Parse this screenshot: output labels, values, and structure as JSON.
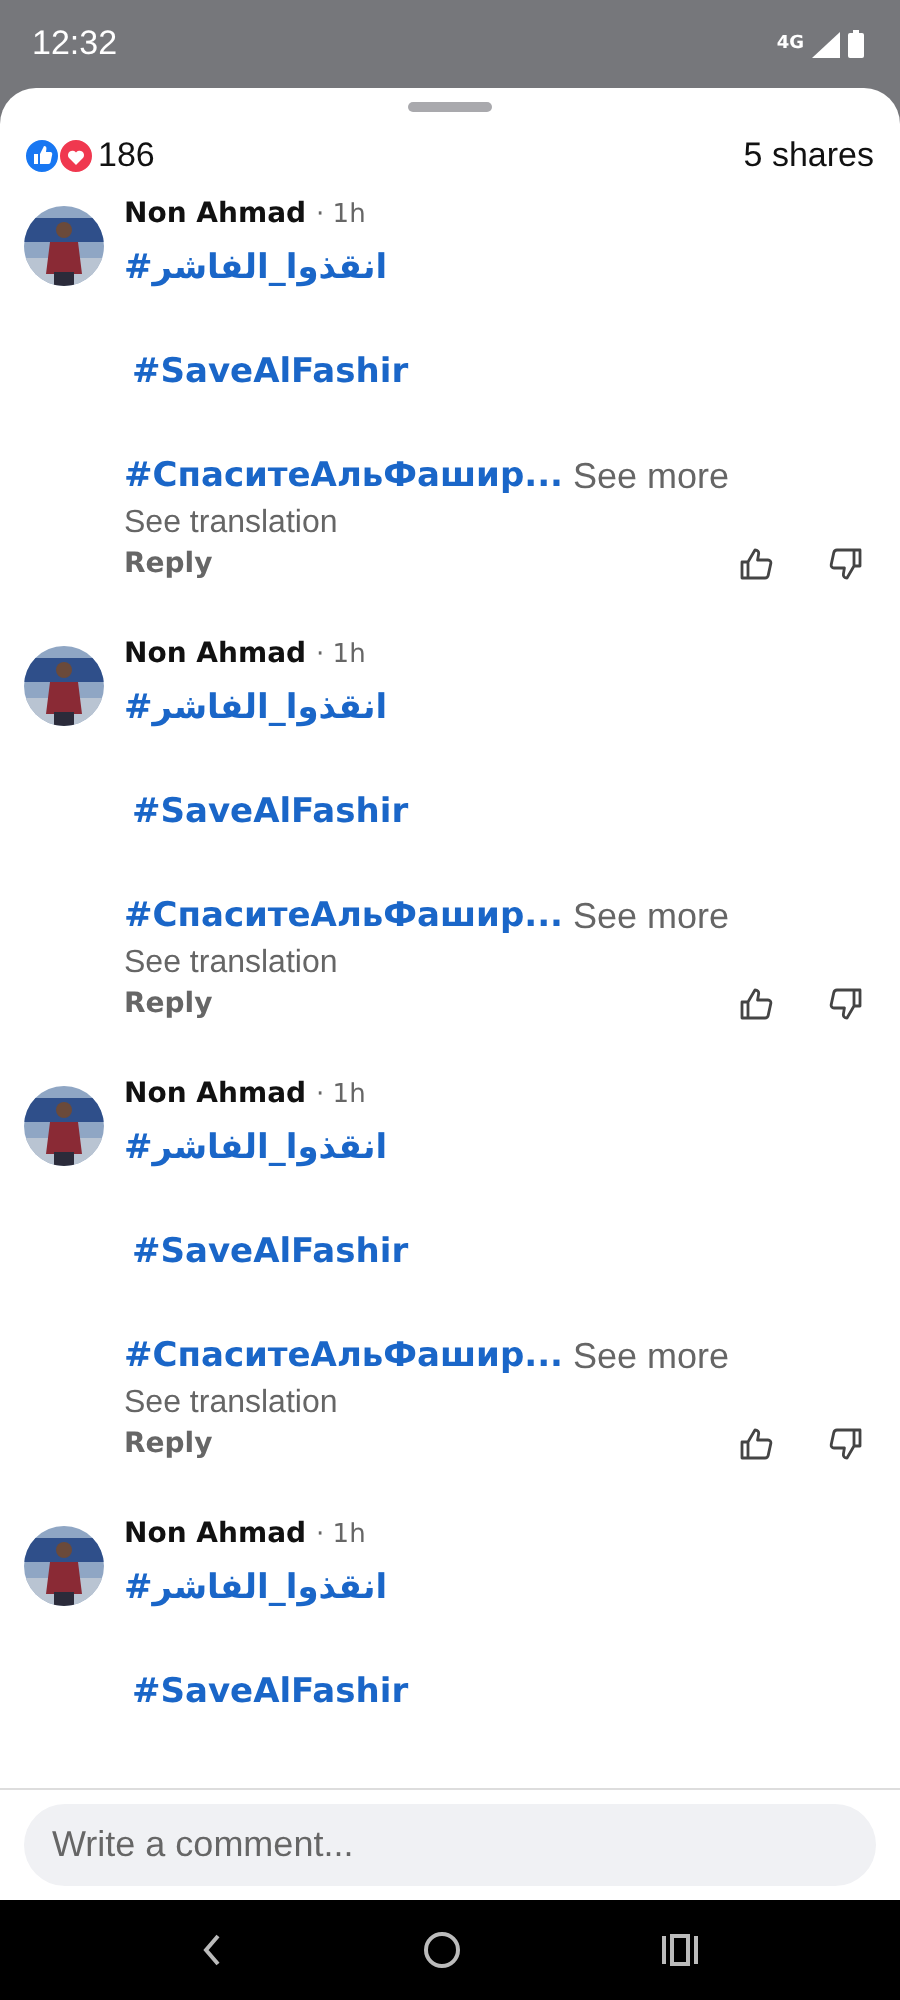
{
  "status_bar": {
    "time": "12:32",
    "network": "4G"
  },
  "summary": {
    "reaction_count": "186",
    "shares": "5 shares"
  },
  "comments": [
    {
      "author": "Non Ahmad",
      "time": "· 1h",
      "tags": [
        "#انقذوا_الفاشر",
        "#SaveAlFashir",
        "#СпаситеАльФашир..."
      ],
      "see_more": "See more",
      "see_translation": "See translation",
      "reply": "Reply"
    },
    {
      "author": "Non Ahmad",
      "time": "· 1h",
      "tags": [
        "#انقذوا_الفاشر",
        "#SaveAlFashir",
        "#СпаситеАльФашир..."
      ],
      "see_more": "See more",
      "see_translation": "See translation",
      "reply": "Reply"
    },
    {
      "author": "Non Ahmad",
      "time": "· 1h",
      "tags": [
        "#انقذوا_الفاشر",
        "#SaveAlFashir",
        "#СпаситеАльФашир..."
      ],
      "see_more": "See more",
      "see_translation": "See translation",
      "reply": "Reply"
    },
    {
      "author": "Non Ahmad",
      "time": "· 1h",
      "tags": [
        "#انقذوا_الفاشر",
        "#SaveAlFashir"
      ]
    }
  ],
  "composer": {
    "placeholder": "Write a comment..."
  }
}
